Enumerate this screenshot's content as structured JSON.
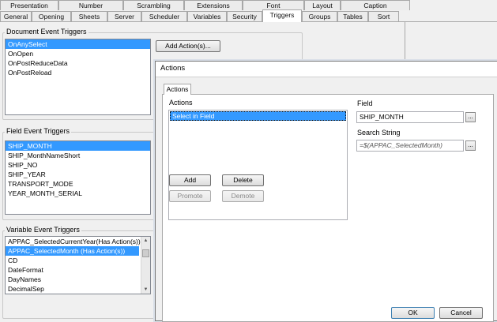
{
  "tabs": {
    "row1": [
      "Presentation",
      "Number",
      "Scrambling",
      "Extensions",
      "Font",
      "Layout",
      "Caption"
    ],
    "row2": [
      "General",
      "Opening",
      "Sheets",
      "Server",
      "Scheduler",
      "Variables",
      "Security",
      "Triggers",
      "Groups",
      "Tables",
      "Sort"
    ],
    "active": "Triggers"
  },
  "document_triggers": {
    "title": "Document Event Triggers",
    "items": [
      "OnAnySelect",
      "OnOpen",
      "OnPostReduceData",
      "OnPostReload"
    ],
    "selected_index": 0,
    "add_action_label": "Add Action(s)..."
  },
  "field_triggers": {
    "title": "Field Event Triggers",
    "items": [
      "SHIP_MONTH",
      "SHIP_MonthNameShort",
      "SHIP_NO",
      "SHIP_YEAR",
      "TRANSPORT_MODE",
      "YEAR_MONTH_SERIAL"
    ],
    "selected_index": 0
  },
  "variable_triggers": {
    "title": "Variable Event Triggers",
    "items": [
      "APPAC_SelectedCurrentYear(Has Action(s))",
      "APPAC_SelectedMonth (Has Action(s))",
      "CD",
      "DateFormat",
      "DayNames",
      "DecimalSep"
    ],
    "selected_index": 1
  },
  "actions_dialog": {
    "title": "Actions",
    "tab_label": "Actions",
    "actions_label": "Actions",
    "actions_items": [
      "Select in Field"
    ],
    "field_label": "Field",
    "field_value": "SHIP_MONTH",
    "search_label": "Search String",
    "search_value": "=$(APPAC_SelectedMonth)",
    "ellipsis": "...",
    "add_label": "Add",
    "delete_label": "Delete",
    "promote_label": "Promote",
    "demote_label": "Demote",
    "ok_label": "OK",
    "cancel_label": "Cancel"
  },
  "colors": {
    "selection": "#3399ff",
    "window_bg": "#f0f0f0"
  }
}
